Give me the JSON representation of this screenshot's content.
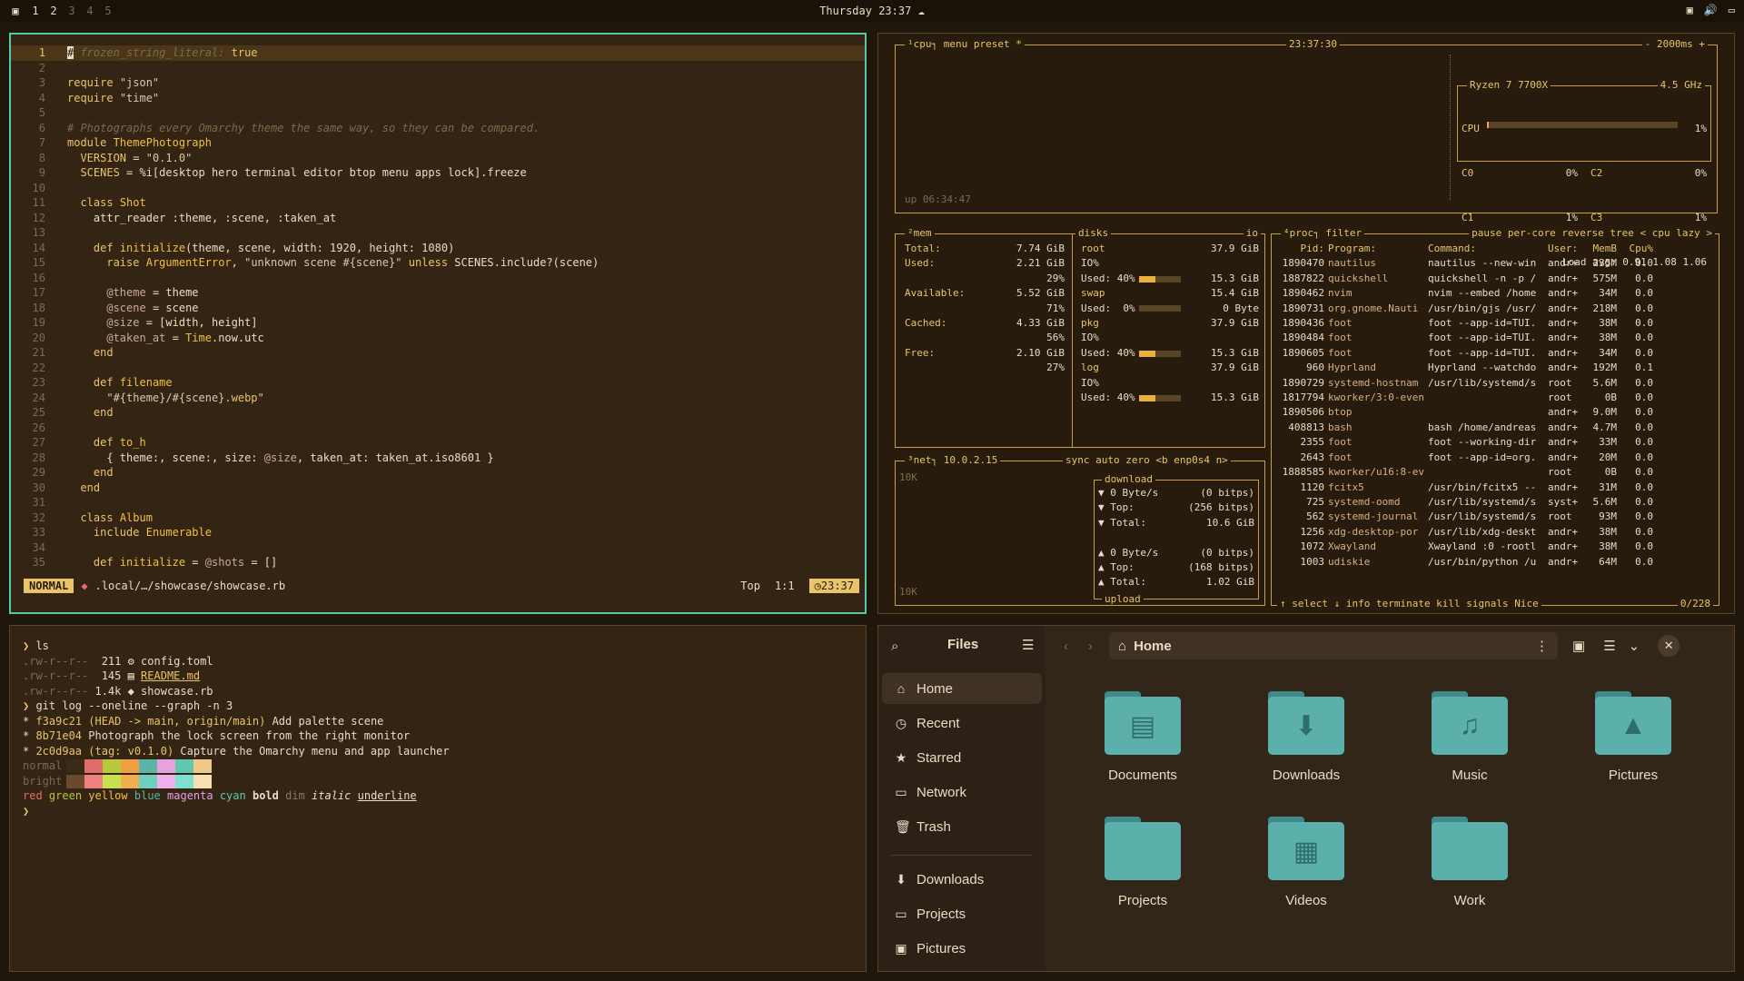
{
  "topbar": {
    "workspaces": [
      "1",
      "2",
      "3",
      "4",
      "5"
    ],
    "clock": "Thursday 23:37"
  },
  "editor": {
    "lines": [
      {
        "n": "1",
        "html": "<span style=\"background:#e9dcc3;color:#2a1d0d\">#</span><span class=\"cm\"> frozen_string_literal: </span><span class=\"kw\">true</span>"
      },
      {
        "n": "2",
        "html": ""
      },
      {
        "n": "3",
        "html": "<span class=\"kw\">require</span> <span class=\"str\">\"json\"</span>"
      },
      {
        "n": "4",
        "html": "<span class=\"kw\">require</span> <span class=\"str\">\"time\"</span>"
      },
      {
        "n": "5",
        "html": ""
      },
      {
        "n": "6",
        "html": "<span class=\"cm\"># Photographs every Omarchy theme the same way, so they can be compared.</span>"
      },
      {
        "n": "7",
        "html": "<span class=\"kw\">module</span> <span class=\"fn\">ThemePhotograph</span>"
      },
      {
        "n": "8",
        "html": "  <span class=\"kw\">VERSION</span> = <span class=\"str\">\"0.1.0\"</span>"
      },
      {
        "n": "9",
        "html": "  <span class=\"kw\">SCENES</span> = %i[desktop hero terminal editor btop menu apps lock].freeze"
      },
      {
        "n": "10",
        "html": ""
      },
      {
        "n": "11",
        "html": "  <span class=\"kw\">class</span> <span class=\"fn\">Shot</span>"
      },
      {
        "n": "12",
        "html": "    attr_reader :theme, :scene, :taken_at"
      },
      {
        "n": "13",
        "html": ""
      },
      {
        "n": "14",
        "html": "    <span class=\"kw\">def</span> <span class=\"fn\">initialize</span>(theme, scene, width: 1920, height: 1080)"
      },
      {
        "n": "15",
        "html": "      <span class=\"kw\">raise</span> <span class=\"fn\">ArgumentError</span>, <span class=\"str\">\"unknown scene #{scene}\"</span> <span class=\"kw\">unless</span> SCENES.include?(scene)"
      },
      {
        "n": "16",
        "html": ""
      },
      {
        "n": "17",
        "html": "      <span class=\"iv\">@theme</span> = theme"
      },
      {
        "n": "18",
        "html": "      <span class=\"iv\">@scene</span> = scene"
      },
      {
        "n": "19",
        "html": "      <span class=\"iv\">@size</span> = [width, height]"
      },
      {
        "n": "20",
        "html": "      <span class=\"iv\">@taken_at</span> = <span class=\"fn\">Time</span>.now.utc"
      },
      {
        "n": "21",
        "html": "    <span class=\"kw\">end</span>"
      },
      {
        "n": "22",
        "html": ""
      },
      {
        "n": "23",
        "html": "    <span class=\"kw\">def</span> <span class=\"fn\">filename</span>"
      },
      {
        "n": "24",
        "html": "      <span class=\"str\">\"#{theme}/#{scene}</span><span class=\"kw\">.webp</span><span class=\"str\">\"</span>"
      },
      {
        "n": "25",
        "html": "    <span class=\"kw\">end</span>"
      },
      {
        "n": "26",
        "html": ""
      },
      {
        "n": "27",
        "html": "    <span class=\"kw\">def</span> <span class=\"fn\">to_h</span>"
      },
      {
        "n": "28",
        "html": "      { theme:, scene:, size: <span class=\"iv\">@size</span>, taken_at: taken_at.iso8601 }"
      },
      {
        "n": "29",
        "html": "    <span class=\"kw\">end</span>"
      },
      {
        "n": "30",
        "html": "  <span class=\"kw\">end</span>"
      },
      {
        "n": "31",
        "html": ""
      },
      {
        "n": "32",
        "html": "  <span class=\"kw\">class</span> <span class=\"fn\">Album</span>"
      },
      {
        "n": "33",
        "html": "    <span class=\"kw\">include</span> <span class=\"fn\">Enumerable</span>"
      },
      {
        "n": "34",
        "html": ""
      },
      {
        "n": "35",
        "html": "    <span class=\"kw\">def</span> <span class=\"fn\">initialize</span> = <span class=\"iv\">@shots</span> = []"
      }
    ],
    "status": {
      "mode": "NORMAL",
      "file": ".local/…/showcase/showcase.rb",
      "position": "Top",
      "cursor": "1:1",
      "time": "23:37"
    }
  },
  "btop": {
    "cpu": {
      "title_left": "¹cpu",
      "menu": "menu",
      "preset": "preset *",
      "time": "23:37:30",
      "interval": "- 2000ms +",
      "model": "Ryzen 7 7700X",
      "freq": "4.5 GHz",
      "uptime": "up 06:34:47",
      "rows": [
        {
          "label": "CPU",
          "pct": "1%",
          "fill": 0.01
        },
        {
          "label": "C0",
          "pct": "0%",
          "label2": "C2",
          "pct2": "0%"
        },
        {
          "label": "C1",
          "pct": "1%",
          "label2": "C3",
          "pct2": "1%"
        }
      ],
      "load": "Load avg: 0.91 1.08 1.06"
    },
    "mem": {
      "title": "²mem",
      "rows": [
        {
          "k": "Total:",
          "v": "7.74 GiB"
        },
        {
          "k": "Used:",
          "v": "2.21 GiB"
        },
        {
          "k": "",
          "v": "29%"
        },
        {
          "k": "Available:",
          "v": "5.52 GiB"
        },
        {
          "k": "",
          "v": "71%"
        },
        {
          "k": "Cached:",
          "v": "4.33 GiB"
        },
        {
          "k": "",
          "v": "56%"
        },
        {
          "k": "Free:",
          "v": "2.10 GiB"
        },
        {
          "k": "",
          "v": "27%"
        }
      ]
    },
    "disks": {
      "title": "disks",
      "io": "io",
      "rows": [
        {
          "k": "root",
          "v": "37.9 GiB",
          "head": true
        },
        {
          "k": "IO%",
          "v": ""
        },
        {
          "k": "Used: 40%",
          "v": "15.3 GiB",
          "fill": 0.4
        },
        {
          "k": "swap",
          "v": "15.4 GiB",
          "head": true
        },
        {
          "k": "Used:  0%",
          "v": "0 Byte",
          "fill": 0.0
        },
        {
          "k": "pkg",
          "v": "37.9 GiB",
          "head": true
        },
        {
          "k": "IO%",
          "v": ""
        },
        {
          "k": "Used: 40%",
          "v": "15.3 GiB",
          "fill": 0.4
        },
        {
          "k": "log",
          "v": "37.9 GiB",
          "head": true
        },
        {
          "k": "IO%",
          "v": ""
        },
        {
          "k": "Used: 40%",
          "v": "15.3 GiB",
          "fill": 0.4
        }
      ]
    },
    "net": {
      "title": "³net",
      "ip": "10.0.2.15",
      "opts": "sync auto zero <b enp0s4 n>",
      "scale_top": "10K",
      "scale_bot": "10K",
      "download_label": "download",
      "upload_label": "upload",
      "down": [
        {
          "k": "▼ 0 Byte/s",
          "v": "(0 bitps)"
        },
        {
          "k": "▼ Top:",
          "v": "(256 bitps)"
        },
        {
          "k": "▼ Total:",
          "v": "10.6 GiB"
        }
      ],
      "up": [
        {
          "k": "▲ 0 Byte/s",
          "v": "(0 bitps)"
        },
        {
          "k": "▲ Top:",
          "v": "(168 bitps)"
        },
        {
          "k": "▲ Total:",
          "v": "1.02 GiB"
        }
      ]
    },
    "proc": {
      "title": "⁴proc",
      "opts": "filter",
      "opts_right": "pause per-core reverse tree < cpu lazy >",
      "headers": [
        "Pid:",
        "Program:",
        "Command:",
        "User:",
        "MemB",
        "Cpu%"
      ],
      "rows": [
        [
          "1890470",
          "nautilus",
          "nautilus --new-win",
          "andr+",
          "235M",
          "0.0"
        ],
        [
          "1887822",
          "quickshell",
          "quickshell -n -p /",
          "andr+",
          "575M",
          "0.0"
        ],
        [
          "1890462",
          "nvim",
          "nvim --embed /home",
          "andr+",
          "34M",
          "0.0"
        ],
        [
          "1890731",
          "org.gnome.Nauti",
          "/usr/bin/gjs /usr/",
          "andr+",
          "218M",
          "0.0"
        ],
        [
          "1890436",
          "foot",
          "foot --app-id=TUI.",
          "andr+",
          "38M",
          "0.0"
        ],
        [
          "1890484",
          "foot",
          "foot --app-id=TUI.",
          "andr+",
          "38M",
          "0.0"
        ],
        [
          "1890605",
          "foot",
          "foot --app-id=TUI.",
          "andr+",
          "34M",
          "0.0"
        ],
        [
          "960",
          "Hyprland",
          "Hyprland --watchdo",
          "andr+",
          "192M",
          "0.1"
        ],
        [
          "1890729",
          "systemd-hostnam",
          "/usr/lib/systemd/s",
          "root",
          "5.6M",
          "0.0"
        ],
        [
          "1817794",
          "kworker/3:0-even",
          "",
          "root",
          "0B",
          "0.0"
        ],
        [
          "1890506",
          "btop",
          "",
          "andr+",
          "9.0M",
          "0.0"
        ],
        [
          "408813",
          "bash",
          "bash /home/andreas",
          "andr+",
          "4.7M",
          "0.0"
        ],
        [
          "2355",
          "foot",
          "foot --working-dir",
          "andr+",
          "33M",
          "0.0"
        ],
        [
          "2643",
          "foot",
          "foot --app-id=org.",
          "andr+",
          "20M",
          "0.0"
        ],
        [
          "1888585",
          "kworker/u16:8-ev",
          "",
          "root",
          "0B",
          "0.0"
        ],
        [
          "1120",
          "fcitx5",
          "/usr/bin/fcitx5 --",
          "andr+",
          "31M",
          "0.0"
        ],
        [
          "725",
          "systemd-oomd",
          "/usr/lib/systemd/s",
          "syst+",
          "5.6M",
          "0.0"
        ],
        [
          "562",
          "systemd-journal",
          "/usr/lib/systemd/s",
          "root",
          "93M",
          "0.0"
        ],
        [
          "1256",
          "xdg-desktop-por",
          "/usr/lib/xdg-deskt",
          "andr+",
          "38M",
          "0.0"
        ],
        [
          "1072",
          "Xwayland",
          "Xwayland :0 -rootl",
          "andr+",
          "38M",
          "0.0"
        ],
        [
          "1003",
          "udiskie",
          "/usr/bin/python /u",
          "andr+",
          "64M",
          "0.0"
        ]
      ],
      "footer": "↑ select ↓  info   terminate  kill  signals  Nice",
      "count": "0/228"
    }
  },
  "terminal": {
    "lines": [
      "<span style=\"color:#e9c46a\">❯</span> ls",
      "<span style=\"color:#7d6a4d\">.rw-r--r--</span>  211 ⚙ config.toml",
      "<span style=\"color:#7d6a4d\">.rw-r--r--</span>  145 ▤ <u style=\"color:#e9c46a\">README.md</u>",
      "<span style=\"color:#7d6a4d\">.rw-r--r--</span> 1.4k ◆ showcase.rb",
      "<span style=\"color:#e9c46a\">❯</span> git log --oneline --graph -n 3",
      "* <span style=\"color:#e9c46a\">f3a9c21</span> <span style=\"color:#e9c46a\">(HEAD -&gt; main, origin/main)</span> Add palette scene",
      "* <span style=\"color:#e9c46a\">8b71e04</span> Photograph the lock screen from the right monitor",
      "* <span style=\"color:#e9c46a\">2c0d9aa</span> <span style=\"color:#e9c46a\">(tag: v0.1.0)</span> Capture the Omarchy menu and app launcher"
    ],
    "palette_normal_label": "normal",
    "palette_bright_label": "bright",
    "palette_normal": [
      "#3a2a18",
      "#e06c6c",
      "#b8c83c",
      "#f0a040",
      "#5ab4a8",
      "#e8a0e0",
      "#60c8b0",
      "#f0c888"
    ],
    "palette_bright": [
      "#6a4a2a",
      "#f08080",
      "#c8e050",
      "#f0b050",
      "#70d0c0",
      "#f0b0f0",
      "#80e0d0",
      "#f8e0b0"
    ],
    "styles": [
      {
        "t": "red",
        "c": "#e06c6c"
      },
      {
        "t": "green",
        "c": "#b8c83c"
      },
      {
        "t": "yellow",
        "c": "#f0c040"
      },
      {
        "t": "blue",
        "c": "#5ab4a8"
      },
      {
        "t": "magenta",
        "c": "#e8a0e0"
      },
      {
        "t": "cyan",
        "c": "#60c8b0"
      },
      {
        "t": "bold",
        "c": "#e9dcc3",
        "s": "font-weight:bold"
      },
      {
        "t": "dim",
        "c": "#8a7a5e"
      },
      {
        "t": "italic",
        "c": "#e9dcc3",
        "s": "font-style:italic"
      },
      {
        "t": "underline",
        "c": "#e9dcc3",
        "s": "text-decoration:underline"
      }
    ],
    "prompt": "❯"
  },
  "files": {
    "title": "Files",
    "location": "Home",
    "sidebar": [
      {
        "icon": "⌂",
        "label": "Home",
        "name": "home",
        "active": true
      },
      {
        "icon": "◷",
        "label": "Recent",
        "name": "recent"
      },
      {
        "icon": "★",
        "label": "Starred",
        "name": "starred"
      },
      {
        "icon": "▭",
        "label": "Network",
        "name": "network"
      },
      {
        "icon": "🗑",
        "label": "Trash",
        "name": "trash"
      }
    ],
    "bookmarks": [
      {
        "icon": "⬇",
        "label": "Downloads",
        "name": "downloads"
      },
      {
        "icon": "▭",
        "label": "Projects",
        "name": "projects"
      },
      {
        "icon": "▣",
        "label": "Pictures",
        "name": "pictures"
      }
    ],
    "folders": [
      {
        "label": "Documents",
        "glyph": "▤",
        "name": "documents"
      },
      {
        "label": "Downloads",
        "glyph": "⬇",
        "name": "downloads"
      },
      {
        "label": "Music",
        "glyph": "♫",
        "name": "music"
      },
      {
        "label": "Pictures",
        "glyph": "▲",
        "name": "pictures"
      },
      {
        "label": "Projects",
        "glyph": "",
        "name": "projects"
      },
      {
        "label": "Videos",
        "glyph": "▦",
        "name": "videos"
      },
      {
        "label": "Work",
        "glyph": "",
        "name": "work"
      }
    ]
  }
}
